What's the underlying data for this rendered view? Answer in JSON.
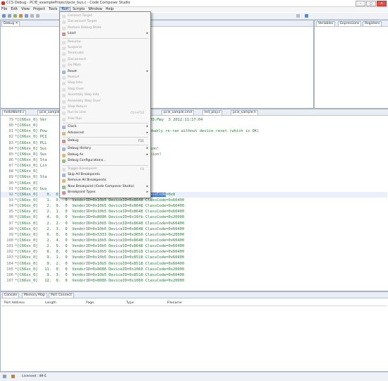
{
  "window": {
    "title": "CCS Debug - PCIE_exampleProject/pcie_bus.c - Code Composer Studio",
    "buttons": [
      "–",
      "□",
      "✕"
    ]
  },
  "menubar": {
    "items": [
      "File",
      "Edit",
      "View",
      "Project",
      "Tools",
      "Run",
      "Scripts",
      "Window",
      "Help"
    ],
    "active": "Run"
  },
  "views": {
    "debug_tab": "Debug",
    "right_tabs": [
      "Variables",
      "Expressions",
      "Registers"
    ]
  },
  "editor": {
    "tabs": [
      "helloWorld.c",
      "pcie_sample.c",
      "pcie_sample.cmd",
      "led_play.c",
      "pcie_sample.h"
    ],
    "lines": [
      {
        "num": "79",
        "text": "*[C66xx_0] Ver"
      },
      {
        "num": "80",
        "text": "*[C66xx_0]"
      },
      {
        "num": "81",
        "text": "*[C66xx_0] Pow"
      },
      {
        "num": "82",
        "text": "*[C66xx_0] PCI"
      },
      {
        "num": "83",
        "text": "*[C66xx_0] PLL"
      },
      {
        "num": "84",
        "text": "*[C66xx_0] Suc"
      },
      {
        "num": "85",
        "text": "*[C66xx_0] Suc"
      },
      {
        "num": "86",
        "text": "*[C66xx_0] Sta"
      },
      {
        "num": "87",
        "text": "*[C66xx_0] Lin"
      },
      {
        "num": "88",
        "text": "*[C66xx_0]"
      },
      {
        "num": "89",
        "text": "*[C66xx_0] Sta"
      },
      {
        "num": "90",
        "text": "*[C66xx_0]"
      },
      {
        "num": "91",
        "text": "*[C66xx_0] bus"
      },
      {
        "num": "92",
        "text": "*[C66xx_0]    0.  0.  0  VendorID=0x104c DeviceID=0xb005 ",
        "sel": "ClassCode",
        "after": "=0x0"
      },
      {
        "num": "93",
        "text": "*[C66xx_0]    1.  0.  0  VendorID=0x10b5 DeviceID=0x8648 ClassCode=0x60400"
      },
      {
        "num": "94",
        "text": "*[C66xx_0]    2.  0.  0  VendorID=0x10b5 DeviceID=0x8648 ClassCode=0x60400"
      },
      {
        "num": "95",
        "text": "*[C66xx_0]    2.  1.  0  VendorID=0x10b5 DeviceID=0x8648 ClassCode=0x60400"
      },
      {
        "num": "96",
        "text": "*[C66xx_0]    4.  0.  0  VendorID=0x8086 DeviceID=0x10fb ClassCode=0x20000"
      },
      {
        "num": "97",
        "text": "*[C66xx_0]    2.  2.  0  VendorID=0x10b5 DeviceID=0x8648 ClassCode=0x60400"
      },
      {
        "num": "98",
        "text": "*[C66xx_0]    2.  3.  0  VendorID=0x10b5 DeviceID=0x8648 ClassCode=0x60400"
      },
      {
        "num": "99",
        "text": "*[C66xx_0]    6.  0.  0  VendorID=0x5333 DeviceID=0x9050 ClassCode=0x20000"
      },
      {
        "num": "100",
        "text": "*[C66xx_0]    2.  4.  0  VendorID=0x10b5 DeviceID=0x8648 ClassCode=0x60400"
      },
      {
        "num": "101",
        "text": "*[C66xx_0]    2.  5.  0  VendorID=0x10b5 DeviceID=0x8648 ClassCode=0x60400"
      },
      {
        "num": "102",
        "text": "*[C66xx_0]    8.  0.  0  VendorID=0x10b5 DeviceID=0x8518 ClassCode=0x60400"
      },
      {
        "num": "103",
        "text": "*[C66xx_0]    9.  1.  0  VendorID=0x10b5 DeviceID=0x8518 ClassCode=0x60400"
      },
      {
        "num": "104",
        "text": "*[C66xx_0]    9.  2.  0  VendorID=0x10b5 DeviceID=0x8518 ClassCode=0x60400"
      },
      {
        "num": "105",
        "text": "*[C66xx_0]   11.  0.  0  VendorID=0x8086 DeviceID=0x1060 ClassCode=0x20000"
      },
      {
        "num": "106",
        "text": "*[C66xx_0]    9.  3.  0  VendorID=0x10b5 DeviceID=0x8518 ClassCode=0x60400"
      },
      {
        "num": "107",
        "text": "*[C66xx_0]   12.  0.  0  VendorID=0x8086 DeviceID=0x1060 ClassCode=0x20000"
      }
    ],
    "partial_texts": {
      "line79_tail": "Revision: 01.00.00.03:May  3 2012:11:17:04",
      "line81_tail": "probably re-ran without device reset (which is OK)",
      "line84_tail": "ation!",
      "line85_tail": "lation!"
    }
  },
  "console": {
    "tabs": [
      "Console",
      "Memory Map",
      "Port Connect"
    ],
    "columns": [
      "Port Address",
      "Length",
      "Page",
      "Type",
      "Filename"
    ]
  },
  "status": {
    "license": "Licensed : 89 E"
  },
  "run_menu": [
    {
      "label": "Connect Target",
      "disabled": true
    },
    {
      "label": "Disconnect Target",
      "disabled": true
    },
    {
      "label": "Restore Debug State",
      "disabled": true
    },
    {
      "label": "Load",
      "disabled": false,
      "submenu": true
    },
    {
      "sep": true
    },
    {
      "label": "Resume",
      "disabled": true
    },
    {
      "label": "Suspend",
      "disabled": true
    },
    {
      "label": "Terminate",
      "disabled": true
    },
    {
      "label": "Disconnect",
      "disabled": true
    },
    {
      "label": "Go Main",
      "disabled": true
    },
    {
      "label": "Reset",
      "disabled": false,
      "submenu": true
    },
    {
      "label": "Restart",
      "disabled": true
    },
    {
      "label": "Step Into",
      "disabled": true
    },
    {
      "label": "Step Over",
      "disabled": true
    },
    {
      "label": "Assembly Step Into",
      "disabled": true
    },
    {
      "label": "Assembly Step Over",
      "disabled": true
    },
    {
      "label": "Step Return",
      "disabled": true
    },
    {
      "label": "Run to Line",
      "disabled": true,
      "shortcut": "Ctrl+F10"
    },
    {
      "label": "Free Run",
      "disabled": true
    },
    {
      "sep": true
    },
    {
      "label": "Clock",
      "disabled": false,
      "submenu": true
    },
    {
      "label": "Advanced",
      "disabled": false,
      "submenu": true
    },
    {
      "sep": true
    },
    {
      "label": "Debug",
      "disabled": false,
      "shortcut": "F11"
    },
    {
      "sep": true
    },
    {
      "label": "Debug History",
      "disabled": false,
      "submenu": true
    },
    {
      "label": "Debug As",
      "disabled": false,
      "submenu": true
    },
    {
      "label": "Debug Configurations...",
      "disabled": false
    },
    {
      "sep": true
    },
    {
      "label": "Toggle Breakpoint",
      "disabled": true,
      "shortcut": "F8"
    },
    {
      "label": "Skip All Breakpoints",
      "disabled": false
    },
    {
      "label": "Remove All Breakpoints",
      "disabled": false
    },
    {
      "label": "New Breakpoint (Code Composer Studio)",
      "disabled": false,
      "submenu": true
    },
    {
      "label": "Breakpoint Types",
      "disabled": false,
      "submenu": true
    }
  ]
}
